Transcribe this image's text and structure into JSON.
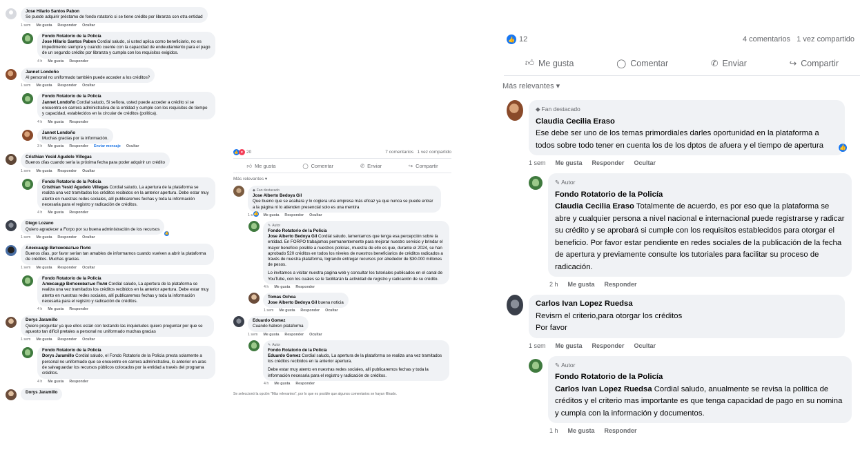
{
  "badges": {
    "author": "Autor",
    "top_fan": "Fan destacado"
  },
  "actions": {
    "like": "Me gusta",
    "reply": "Responder",
    "hide": "Ocultar",
    "send_message": "Enviar mensaje"
  },
  "left": {
    "comments": [
      {
        "id": "l1",
        "avatar": "gray",
        "name": "Jose Hilario Santos Pabon",
        "text": "Se puede adquirir préstamo de fondo rotatorio si se tiene crédito por libranza con otra entidad",
        "time": "1 sem",
        "meta": [
          "like",
          "reply",
          "hide"
        ]
      },
      {
        "id": "l2",
        "avatar": "green",
        "reply": true,
        "badge": false,
        "name": "Fondo Rotatorio de la Policía",
        "mention": "Jose Hilario Santos Pabon",
        "text": "Cordial saludo, si usted aplica como beneficiario, no es impedimento siempre y cuando cuente con la capacidad de endeudamiento para el pago de un segundo crédito por libranza y cumpla con los requisitos exigidos.",
        "time": "4 h",
        "meta": [
          "like",
          "reply"
        ]
      },
      {
        "id": "l3",
        "avatar": "photo1",
        "name": "Jannet Londoño",
        "text": "Al personal no uniformado también puede acceder a los créditos?",
        "time": "1 sem",
        "meta": [
          "like",
          "reply",
          "hide"
        ]
      },
      {
        "id": "l4",
        "avatar": "green",
        "reply": true,
        "name": "Fondo Rotatorio de la Policía",
        "mention": "Jannet Londoño",
        "text": "Cordial saludo, Si señora, usted puede acceder a crédito si se encuentra en carrera administrativa de la entidad y cumple con los requisitos de tiempo y capacidad, establecidos en la circular de créditos (política).",
        "time": "4 h",
        "meta": [
          "like",
          "reply"
        ]
      },
      {
        "id": "l5",
        "avatar": "photo1",
        "reply": true,
        "name": "Jannet Londoño",
        "text": "Muchas gracias por la información.",
        "time": "3 h",
        "meta": [
          "like",
          "reply",
          "send_message",
          "hide"
        ]
      },
      {
        "id": "l6",
        "avatar": "photo2",
        "name": "Cristhian Yesid Agudelo Villegas",
        "text": "Buenos días cuando sería la próxima fecha para poder adquirir un crédito",
        "time": "1 sem",
        "meta": [
          "like",
          "reply",
          "hide"
        ]
      },
      {
        "id": "l7",
        "avatar": "green",
        "reply": true,
        "name": "Fondo Rotatorio de la Policía",
        "mention": "Cristhian Yesid Agudelo Villegas",
        "text": "Cordial saludo, La apertura de la plataforma se realiza una vez tramitados los créditos recibidos en la anterior apertura. Debe estar muy atento en nuestras redes sociales, allí publicaremos fechas y toda la información necesaria para el registro y radicación de créditos.",
        "time": "4 h",
        "meta": [
          "like",
          "reply"
        ]
      },
      {
        "id": "l8",
        "avatar": "photo3",
        "name": "Diego Lozano",
        "text": "Quiero agradecer a Forpo por su buena administración de los recursos",
        "time": "1 sem",
        "meta": [
          "like",
          "reply",
          "hide"
        ],
        "liked": true
      },
      {
        "id": "l9",
        "avatar": "photo4",
        "name": "Александр Витюковатые Поля",
        "text": "Buenos días, por favor serían tan amables de informarnos cuando vuelven a abrir la plataforma de créditos. Muchas gracias.",
        "time": "1 sem",
        "meta": [
          "like",
          "reply",
          "hide"
        ]
      },
      {
        "id": "l10",
        "avatar": "green",
        "reply": true,
        "name": "Fondo Rotatorio de la Policía",
        "mention": "Александр Витюковатые Поля",
        "text": "Cordial saludo, La apertura de la plataforma se realiza una vez tramitados los créditos recibidos en la anterior apertura. Debe estar muy atento en nuestras redes sociales, allí publicaremos fechas y toda la información necesaria para el registro y radicación de créditos.",
        "time": "4 h",
        "meta": [
          "like",
          "reply"
        ]
      },
      {
        "id": "l11",
        "avatar": "photo5",
        "name": "Dorys Jaramillo",
        "text": "Quiero preguntar ya que ellos están con testando las inquietudes quiero preguntar por que se apuesto tan difícil pretales a personal no uniformado muchas gracias",
        "time": "1 sem",
        "meta": [
          "like",
          "reply",
          "hide"
        ]
      },
      {
        "id": "l12",
        "avatar": "green",
        "reply": true,
        "name": "Fondo Rotatorio de la Policía",
        "mention": "Dorys Jaramillo",
        "text": "Cordial saludo, el Fondo Rotatorio de la Policía presta solamente a personal no uniformado que se encuentre en carrera administrativa, lo anterior en aras de salvaguardar los recursos públicos colocados por la entidad a través del programa créditos.",
        "time": "4 h",
        "meta": [
          "like",
          "reply"
        ]
      },
      {
        "id": "l13",
        "avatar": "photo5",
        "name": "Dorys Jaramillo",
        "text": "",
        "time": "",
        "meta": []
      }
    ]
  },
  "mid": {
    "reaction_count": "20",
    "comment_count": "7 comentarios",
    "share_count": "1 vez compartido",
    "action_like": "Me gusta",
    "action_comment": "Comentar",
    "action_send": "Enviar",
    "action_share": "Compartir",
    "sort_label": "Más relevantes",
    "footer": "Se seleccionó la opción \"Más relevantes\", por lo que es posible que algunos comentarios se hayan filtrado.",
    "comments": [
      {
        "id": "m1",
        "avatar": "photo6",
        "badge": "top_fan",
        "name": "Jose Alberto Bedoya Gil",
        "text": "Que bueno que se acabara y lo cogiera una empresa más eficaz ya que nunca se puede entrar a la página ni lo atienden presencial solo es una mentira",
        "time": "1 sem",
        "meta": [
          "like",
          "reply",
          "hide"
        ],
        "liked": true
      },
      {
        "id": "m2",
        "avatar": "green",
        "reply": true,
        "badge": "author",
        "name": "Fondo Rotatorio de la Policía",
        "mention": "Jose Alberto Bedoya Gil",
        "text": "Cordial saludo, lamentamos que tenga esa percepción sobre la entidad. En FORPO trabajamos permanentemente para mejorar nuestro servicio y brindar el mayor beneficio posible a nuestros policías, muestra de ello es que, durante el 2024, se han aprobado 520 créditos en todos los niveles de nuestros beneficiarios de créditos radicados a través de nuestra plataforma, logrando entregar recursos por alrededor de $30.000 millones de pesos.",
        "text2": "Lo invitamos a visitar nuestra pagina web y consultar los tutoriales publicados en el canal de YouTube, con los cuales se le facilitarán la actividad de registro y radicación de su crédito.",
        "time": "4 h",
        "meta": [
          "like",
          "reply"
        ]
      },
      {
        "id": "m3",
        "avatar": "photo5",
        "reply": true,
        "name": "Tomas Ochoa",
        "mention": "Jose Alberto Bedoya Gil",
        "text": "buena noticia",
        "time": "1 sem",
        "meta": [
          "like",
          "reply",
          "hide"
        ]
      },
      {
        "id": "m4",
        "avatar": "photo3",
        "name": "Eduardo Gomez",
        "text": "Cuando habren plataforma",
        "time": "1 sem",
        "meta": [
          "like",
          "reply",
          "hide"
        ]
      },
      {
        "id": "m5",
        "avatar": "green",
        "reply": true,
        "badge": "author",
        "name": "Fondo Rotatorio de la Policía",
        "mention": "Eduardo Gomez",
        "text": "Cordial saludo, La apertura de la plataforma se realiza una vez tramitados los créditos recibidos en la anterior apertura.",
        "text2": "Debe estar muy atento en nuestras redes sociales, allí publicaremos fechas y toda la información necesaria para el registro y radicación de créditos.",
        "time": "4 h",
        "meta": [
          "like",
          "reply"
        ]
      }
    ]
  },
  "right": {
    "reaction_count": "12",
    "comment_count": "4 comentarios",
    "share_count": "1 vez compartido",
    "action_like": "Me gusta",
    "action_comment": "Comentar",
    "action_send": "Enviar",
    "action_share": "Compartir",
    "sort_label": "Más relevantes",
    "comments": [
      {
        "id": "r1",
        "avatar": "photo1",
        "badge": "top_fan",
        "name": "Claudia Cecilia Eraso",
        "text": "Ese debe ser uno de los temas primordiales darles oportunidad en la plataforma a todos sobre todo tener en cuenta los de los dptos de afuera y el tiempo de apertura",
        "time": "1 sem",
        "meta": [
          "like",
          "reply",
          "hide"
        ],
        "liked": true
      },
      {
        "id": "r2",
        "avatar": "green",
        "reply": true,
        "badge": "author",
        "name": "Fondo Rotatorio de la Policía",
        "mention": "Claudia Cecilia Eraso",
        "text": "Totalmente de acuerdo, es por eso que la plataforma se abre y cualquier persona a nivel nacional e internacional puede registrarse y radicar su crédito y se aprobará si cumple con los requisitos establecidos para otorgar el beneficio. Por favor estar pendiente en redes sociales de la publicación de la fecha de apertura y previamente consulte los tutoriales para facilitar su proceso de radicación.",
        "time": "2 h",
        "meta": [
          "like",
          "reply"
        ]
      },
      {
        "id": "r3",
        "avatar": "photo3",
        "name": "Carlos Ivan Lopez Ruedsa",
        "text": "Revisrn el criterio,para otorgar los créditos",
        "text2": "Por favor",
        "time": "1 sem",
        "meta": [
          "like",
          "reply",
          "hide"
        ]
      },
      {
        "id": "r4",
        "avatar": "green",
        "reply": true,
        "badge": "author",
        "name": "Fondo Rotatorio de la Policía",
        "mention": "Carlos Ivan Lopez Ruedsa",
        "text": "Cordial saludo, anualmente se revisa la política de créditos y el criterio mas importante es que tenga capacidad de pago en su nomina y cumpla con la información y documentos.",
        "time": "1 h",
        "meta": [
          "like",
          "reply"
        ]
      }
    ]
  }
}
